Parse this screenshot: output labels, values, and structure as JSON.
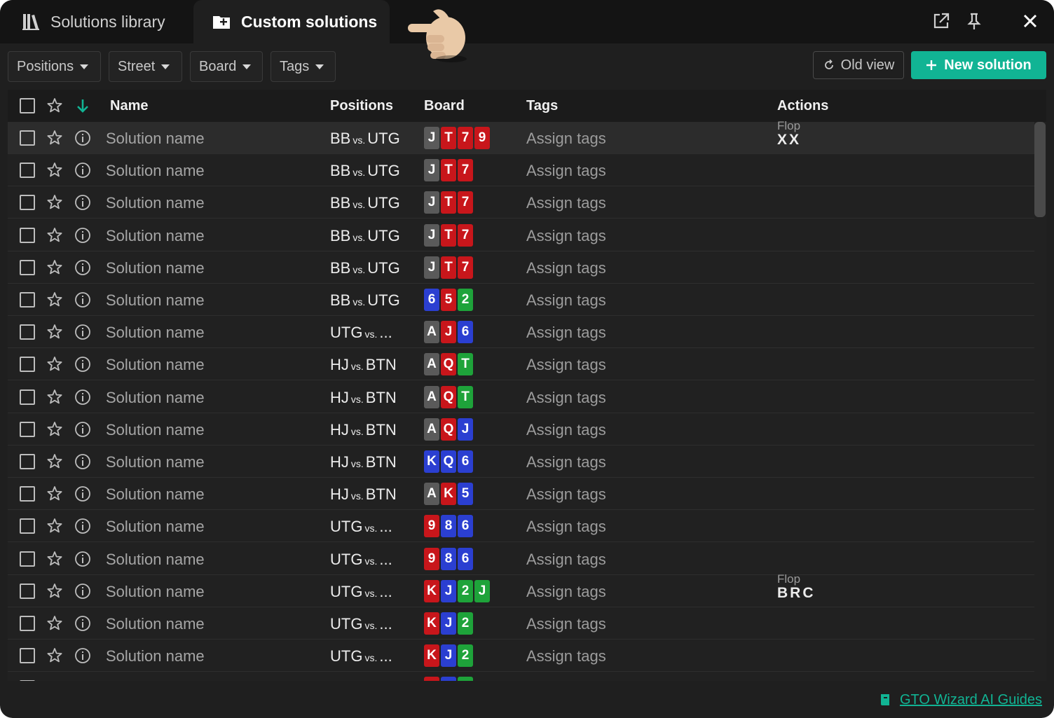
{
  "tabs": [
    {
      "label": "Solutions library",
      "icon": "library-icon"
    },
    {
      "label": "Custom solutions",
      "icon": "folder-add-icon",
      "active": true
    }
  ],
  "window_controls": [
    "open-external-icon",
    "pin-icon",
    "close-icon"
  ],
  "filters": [
    {
      "label": "Positions"
    },
    {
      "label": "Street"
    },
    {
      "label": "Board"
    },
    {
      "label": "Tags"
    }
  ],
  "toolbar": {
    "old_view_label": "Old view",
    "new_solution_label": "New solution"
  },
  "table": {
    "headers": {
      "name": "Name",
      "positions": "Positions",
      "board": "Board",
      "tags": "Tags",
      "actions": "Actions"
    },
    "rows": [
      {
        "name": "Solution name",
        "pos_a": "BB",
        "vs": "vs.",
        "pos_b": "UTG",
        "cards": [
          {
            "r": "J",
            "s": "gray"
          },
          {
            "r": "T",
            "s": "red"
          },
          {
            "r": "7",
            "s": "red"
          },
          {
            "r": "9",
            "s": "red"
          }
        ],
        "tags": "Assign tags",
        "action_label": "Flop",
        "action_value": "XX"
      },
      {
        "name": "Solution name",
        "pos_a": "BB",
        "vs": "vs.",
        "pos_b": "UTG",
        "cards": [
          {
            "r": "J",
            "s": "gray"
          },
          {
            "r": "T",
            "s": "red"
          },
          {
            "r": "7",
            "s": "red"
          }
        ],
        "tags": "Assign tags"
      },
      {
        "name": "Solution name",
        "pos_a": "BB",
        "vs": "vs.",
        "pos_b": "UTG",
        "cards": [
          {
            "r": "J",
            "s": "gray"
          },
          {
            "r": "T",
            "s": "red"
          },
          {
            "r": "7",
            "s": "red"
          }
        ],
        "tags": "Assign tags"
      },
      {
        "name": "Solution name",
        "pos_a": "BB",
        "vs": "vs.",
        "pos_b": "UTG",
        "cards": [
          {
            "r": "J",
            "s": "gray"
          },
          {
            "r": "T",
            "s": "red"
          },
          {
            "r": "7",
            "s": "red"
          }
        ],
        "tags": "Assign tags"
      },
      {
        "name": "Solution name",
        "pos_a": "BB",
        "vs": "vs.",
        "pos_b": "UTG",
        "cards": [
          {
            "r": "J",
            "s": "gray"
          },
          {
            "r": "T",
            "s": "red"
          },
          {
            "r": "7",
            "s": "red"
          }
        ],
        "tags": "Assign tags"
      },
      {
        "name": "Solution name",
        "pos_a": "BB",
        "vs": "vs.",
        "pos_b": "UTG",
        "cards": [
          {
            "r": "6",
            "s": "blue"
          },
          {
            "r": "5",
            "s": "red"
          },
          {
            "r": "2",
            "s": "green"
          }
        ],
        "tags": "Assign tags"
      },
      {
        "name": "Solution name",
        "pos_a": "UTG",
        "vs": "vs.",
        "pos_b": "...",
        "cards": [
          {
            "r": "A",
            "s": "gray"
          },
          {
            "r": "J",
            "s": "red"
          },
          {
            "r": "6",
            "s": "blue"
          }
        ],
        "tags": "Assign tags"
      },
      {
        "name": "Solution name",
        "pos_a": "HJ",
        "vs": "vs.",
        "pos_b": "BTN",
        "cards": [
          {
            "r": "A",
            "s": "gray"
          },
          {
            "r": "Q",
            "s": "red"
          },
          {
            "r": "T",
            "s": "green"
          }
        ],
        "tags": "Assign tags"
      },
      {
        "name": "Solution name",
        "pos_a": "HJ",
        "vs": "vs.",
        "pos_b": "BTN",
        "cards": [
          {
            "r": "A",
            "s": "gray"
          },
          {
            "r": "Q",
            "s": "red"
          },
          {
            "r": "T",
            "s": "green"
          }
        ],
        "tags": "Assign tags"
      },
      {
        "name": "Solution name",
        "pos_a": "HJ",
        "vs": "vs.",
        "pos_b": "BTN",
        "cards": [
          {
            "r": "A",
            "s": "gray"
          },
          {
            "r": "Q",
            "s": "red"
          },
          {
            "r": "J",
            "s": "blue"
          }
        ],
        "tags": "Assign tags"
      },
      {
        "name": "Solution name",
        "pos_a": "HJ",
        "vs": "vs.",
        "pos_b": "BTN",
        "cards": [
          {
            "r": "K",
            "s": "blue"
          },
          {
            "r": "Q",
            "s": "blue"
          },
          {
            "r": "6",
            "s": "blue"
          }
        ],
        "tags": "Assign tags"
      },
      {
        "name": "Solution name",
        "pos_a": "HJ",
        "vs": "vs.",
        "pos_b": "BTN",
        "cards": [
          {
            "r": "A",
            "s": "gray"
          },
          {
            "r": "K",
            "s": "red"
          },
          {
            "r": "5",
            "s": "blue"
          }
        ],
        "tags": "Assign tags"
      },
      {
        "name": "Solution name",
        "pos_a": "UTG",
        "vs": "vs.",
        "pos_b": "...",
        "cards": [
          {
            "r": "9",
            "s": "red"
          },
          {
            "r": "8",
            "s": "blue"
          },
          {
            "r": "6",
            "s": "blue"
          }
        ],
        "tags": "Assign tags"
      },
      {
        "name": "Solution name",
        "pos_a": "UTG",
        "vs": "vs.",
        "pos_b": "...",
        "cards": [
          {
            "r": "9",
            "s": "red"
          },
          {
            "r": "8",
            "s": "blue"
          },
          {
            "r": "6",
            "s": "blue"
          }
        ],
        "tags": "Assign tags"
      },
      {
        "name": "Solution name",
        "pos_a": "UTG",
        "vs": "vs.",
        "pos_b": "...",
        "cards": [
          {
            "r": "K",
            "s": "red"
          },
          {
            "r": "J",
            "s": "blue"
          },
          {
            "r": "2",
            "s": "green"
          },
          {
            "r": "J",
            "s": "green"
          }
        ],
        "tags": "Assign tags",
        "action_label": "Flop",
        "action_value": "BRC"
      },
      {
        "name": "Solution name",
        "pos_a": "UTG",
        "vs": "vs.",
        "pos_b": "...",
        "cards": [
          {
            "r": "K",
            "s": "red"
          },
          {
            "r": "J",
            "s": "blue"
          },
          {
            "r": "2",
            "s": "green"
          }
        ],
        "tags": "Assign tags"
      },
      {
        "name": "Solution name",
        "pos_a": "UTG",
        "vs": "vs.",
        "pos_b": "...",
        "cards": [
          {
            "r": "K",
            "s": "red"
          },
          {
            "r": "J",
            "s": "blue"
          },
          {
            "r": "2",
            "s": "green"
          }
        ],
        "tags": "Assign tags"
      }
    ]
  },
  "suit_colors": {
    "gray": "#5a5a5a",
    "red": "#c8161b",
    "blue": "#2b3fd1",
    "green": "#1ea33a"
  },
  "accent_color": "#11b494",
  "footer": {
    "guides_label": "GTO Wizard AI Guides"
  }
}
